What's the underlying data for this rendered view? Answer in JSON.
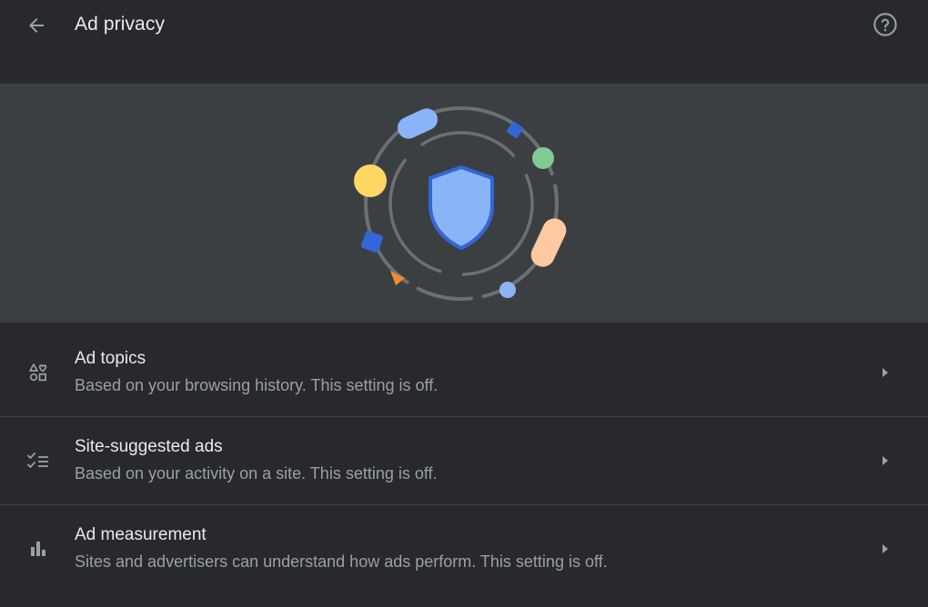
{
  "header": {
    "title": "Ad privacy",
    "back_icon": "arrow-back-icon",
    "help_icon": "help-circle-icon"
  },
  "banner": {
    "illustration": "shield-orbit-illustration",
    "colors": {
      "background": "#3c3f42",
      "shield_fill": "#8ab4f8",
      "shield_stroke": "#3367d6",
      "yellow": "#fdd663",
      "green": "#81c995",
      "peach": "#fcc9a0",
      "blue_light": "#8ab4f8",
      "blue_dark": "#3367d6",
      "orange": "#f28b2e"
    }
  },
  "settings": {
    "items": [
      {
        "icon": "ad-topics-icon",
        "title": "Ad topics",
        "description": "Based on your browsing history. This setting is off."
      },
      {
        "icon": "checklist-icon",
        "title": "Site-suggested ads",
        "description": "Based on your activity on a site. This setting is off."
      },
      {
        "icon": "bar-chart-icon",
        "title": "Ad measurement",
        "description": "Sites and advertisers can understand how ads perform. This setting is off."
      }
    ],
    "chevron_icon": "chevron-right-icon"
  }
}
